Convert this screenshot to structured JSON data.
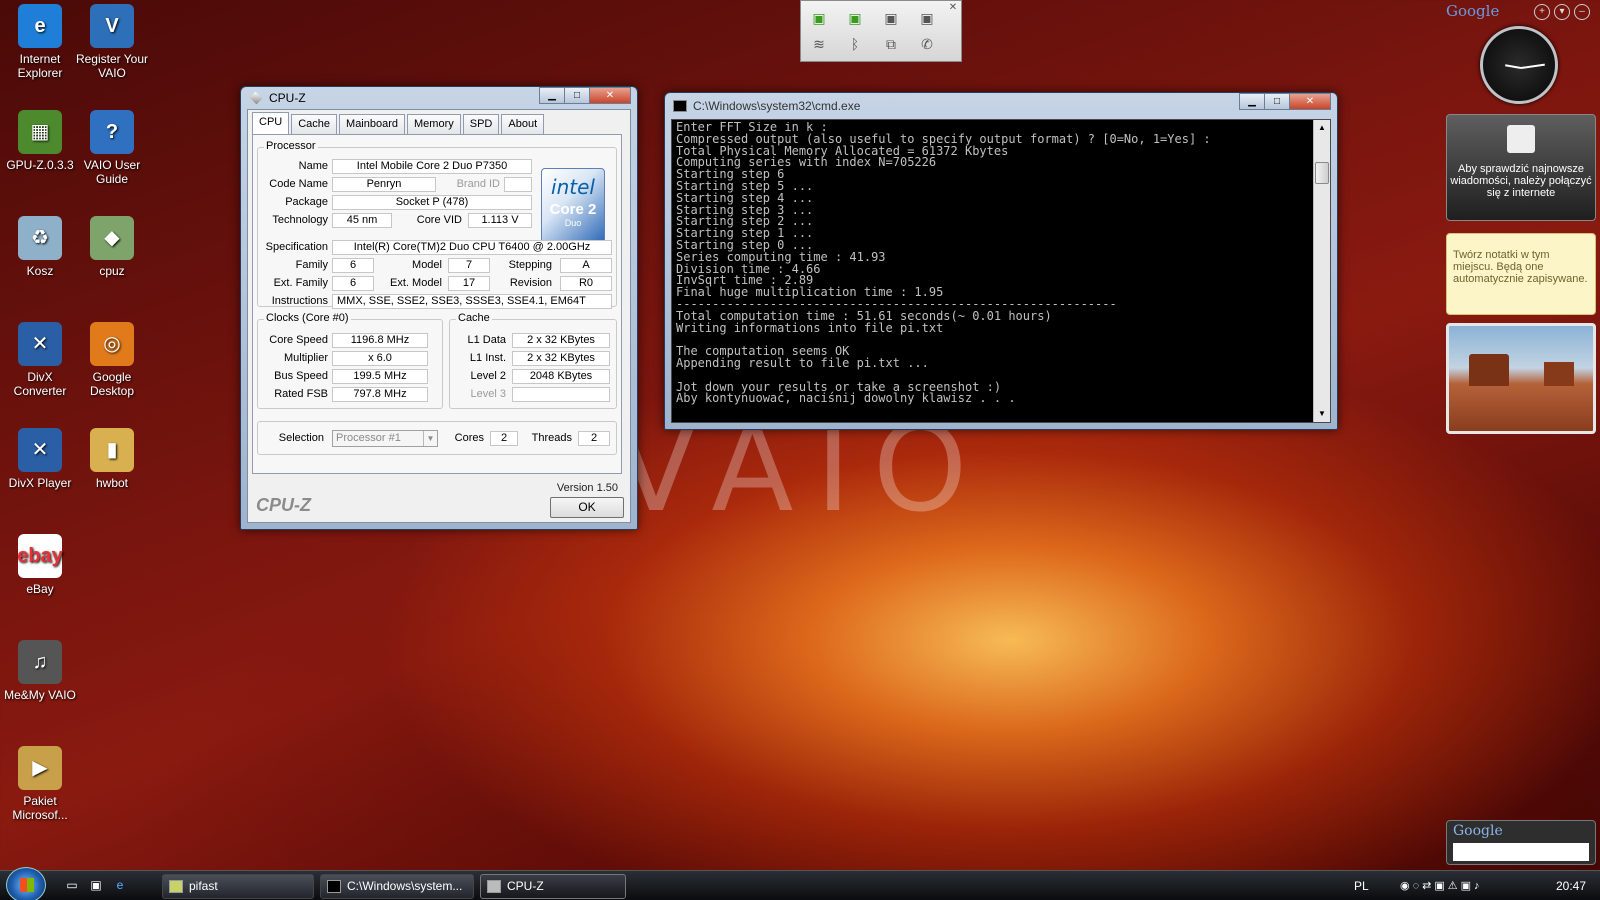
{
  "desktop": {
    "icons": [
      {
        "label": "Internet Explorer",
        "icon": "ie-icon",
        "glyph": "e"
      },
      {
        "label": "Register Your VAIO",
        "icon": "vaio-register-icon",
        "glyph": "V"
      },
      {
        "label": "GPU-Z.0.3.3",
        "icon": "gpuz-icon",
        "glyph": "▦"
      },
      {
        "label": "VAIO User Guide",
        "icon": "vaio-guide-icon",
        "glyph": "?"
      },
      {
        "label": "Kosz",
        "icon": "recycle-bin-icon",
        "glyph": "♻"
      },
      {
        "label": "cpuz",
        "icon": "cpuz-icon",
        "glyph": "◆"
      },
      {
        "label": "DivX Converter",
        "icon": "divx-converter-icon",
        "glyph": "✕"
      },
      {
        "label": "Google Desktop",
        "icon": "google-desktop-icon",
        "glyph": "◎"
      },
      {
        "label": "DivX Player",
        "icon": "divx-player-icon",
        "glyph": "✕"
      },
      {
        "label": "hwbot",
        "icon": "folder-icon",
        "glyph": "▮"
      },
      {
        "label": "eBay",
        "icon": "ebay-icon",
        "glyph": "ebay"
      },
      {
        "label": "Me&My VAIO",
        "icon": "me-my-vaio-icon",
        "glyph": "♫"
      },
      {
        "label": "Pakiet Microsof...",
        "icon": "office-package-icon",
        "glyph": "▶"
      }
    ]
  },
  "cpuz": {
    "title": "CPU-Z",
    "tabs": [
      "CPU",
      "Cache",
      "Mainboard",
      "Memory",
      "SPD",
      "About"
    ],
    "active_tab": "CPU",
    "processor": {
      "group_title": "Processor",
      "name_label": "Name",
      "name": "Intel Mobile Core 2 Duo P7350",
      "codename_label": "Code Name",
      "codename": "Penryn",
      "brandid_label": "Brand ID",
      "brandid": "",
      "package_label": "Package",
      "package": "Socket P (478)",
      "technology_label": "Technology",
      "technology": "45 nm",
      "corevid_label": "Core VID",
      "corevid": "1.113 V",
      "spec_label": "Specification",
      "spec": "Intel(R) Core(TM)2 Duo CPU     T6400  @ 2.00GHz",
      "family_label": "Family",
      "family": "6",
      "model_label": "Model",
      "model": "7",
      "stepping_label": "Stepping",
      "stepping": "A",
      "extfamily_label": "Ext. Family",
      "extfamily": "6",
      "extmodel_label": "Ext. Model",
      "extmodel": "17",
      "revision_label": "Revision",
      "revision": "R0",
      "instructions_label": "Instructions",
      "instructions": "MMX, SSE, SSE2, SSE3, SSSE3, SSE4.1, EM64T",
      "logo_intel": "intel",
      "logo_core": "Core 2",
      "logo_duo": "Duo"
    },
    "clocks": {
      "group_title": "Clocks (Core #0)",
      "corespeed_label": "Core Speed",
      "corespeed": "1196.8 MHz",
      "multiplier_label": "Multiplier",
      "multiplier": "x 6.0",
      "busspeed_label": "Bus Speed",
      "busspeed": "199.5 MHz",
      "ratedfsb_label": "Rated FSB",
      "ratedfsb": "797.8 MHz"
    },
    "cache": {
      "group_title": "Cache",
      "l1data_label": "L1 Data",
      "l1data": "2 x 32 KBytes",
      "l1inst_label": "L1 Inst.",
      "l1inst": "2 x 32 KBytes",
      "level2_label": "Level 2",
      "level2": "2048 KBytes",
      "level3_label": "Level 3",
      "level3": ""
    },
    "selection_label": "Selection",
    "selection": "Processor #1",
    "cores_label": "Cores",
    "cores": "2",
    "threads_label": "Threads",
    "threads": "2",
    "version": "Version 1.50",
    "footer_logo": "CPU-Z",
    "ok_label": "OK"
  },
  "cmd": {
    "title": "C:\\Windows\\system32\\cmd.exe",
    "lines": [
      "Enter FFT Size in k :",
      "Compressed output (also useful to specify output format) ? [0=No, 1=Yes] :",
      "Total Physical Memory Allocated = 61372 Kbytes",
      "Computing series with index N=705226",
      "Starting step 6",
      "Starting step 5 ...",
      "Starting step 4 ...",
      "Starting step 3 ...",
      "Starting step 2 ...",
      "Starting step 1 ...",
      "Starting step 0 ...",
      "Series computing time : 41.93",
      "Division time : 4.66",
      "InvSqrt time : 2.89",
      "Final huge multiplication time : 1.95",
      "-------------------------------------------------------------",
      "Total computation time : 51.61 seconds(~ 0.01 hours)",
      "Writing informations into file pi.txt",
      "",
      "The computation seems OK",
      "Appending result to file pi.txt ...",
      "",
      "Jot down your results or take a screenshot :)",
      "Aby kontynuować, naciśnij dowolny klawisz . . ."
    ]
  },
  "sidebar": {
    "brand": "Google",
    "news_text": "Aby sprawdzić najnowsze wiadomości, należy połączyć się z internete",
    "notes_text": "Twórz notatki w tym miejscu. Będą one automatycznie zapisywane.",
    "search_brand": "Google"
  },
  "watermark": "VAIO",
  "taskbar": {
    "buttons": [
      {
        "label": "pifast",
        "icon": "pifast-icon"
      },
      {
        "label": "C:\\Windows\\system...",
        "icon": "cmd-icon"
      },
      {
        "label": "CPU-Z",
        "icon": "cpuz-icon"
      }
    ],
    "language": "PL",
    "time": "20:47"
  }
}
